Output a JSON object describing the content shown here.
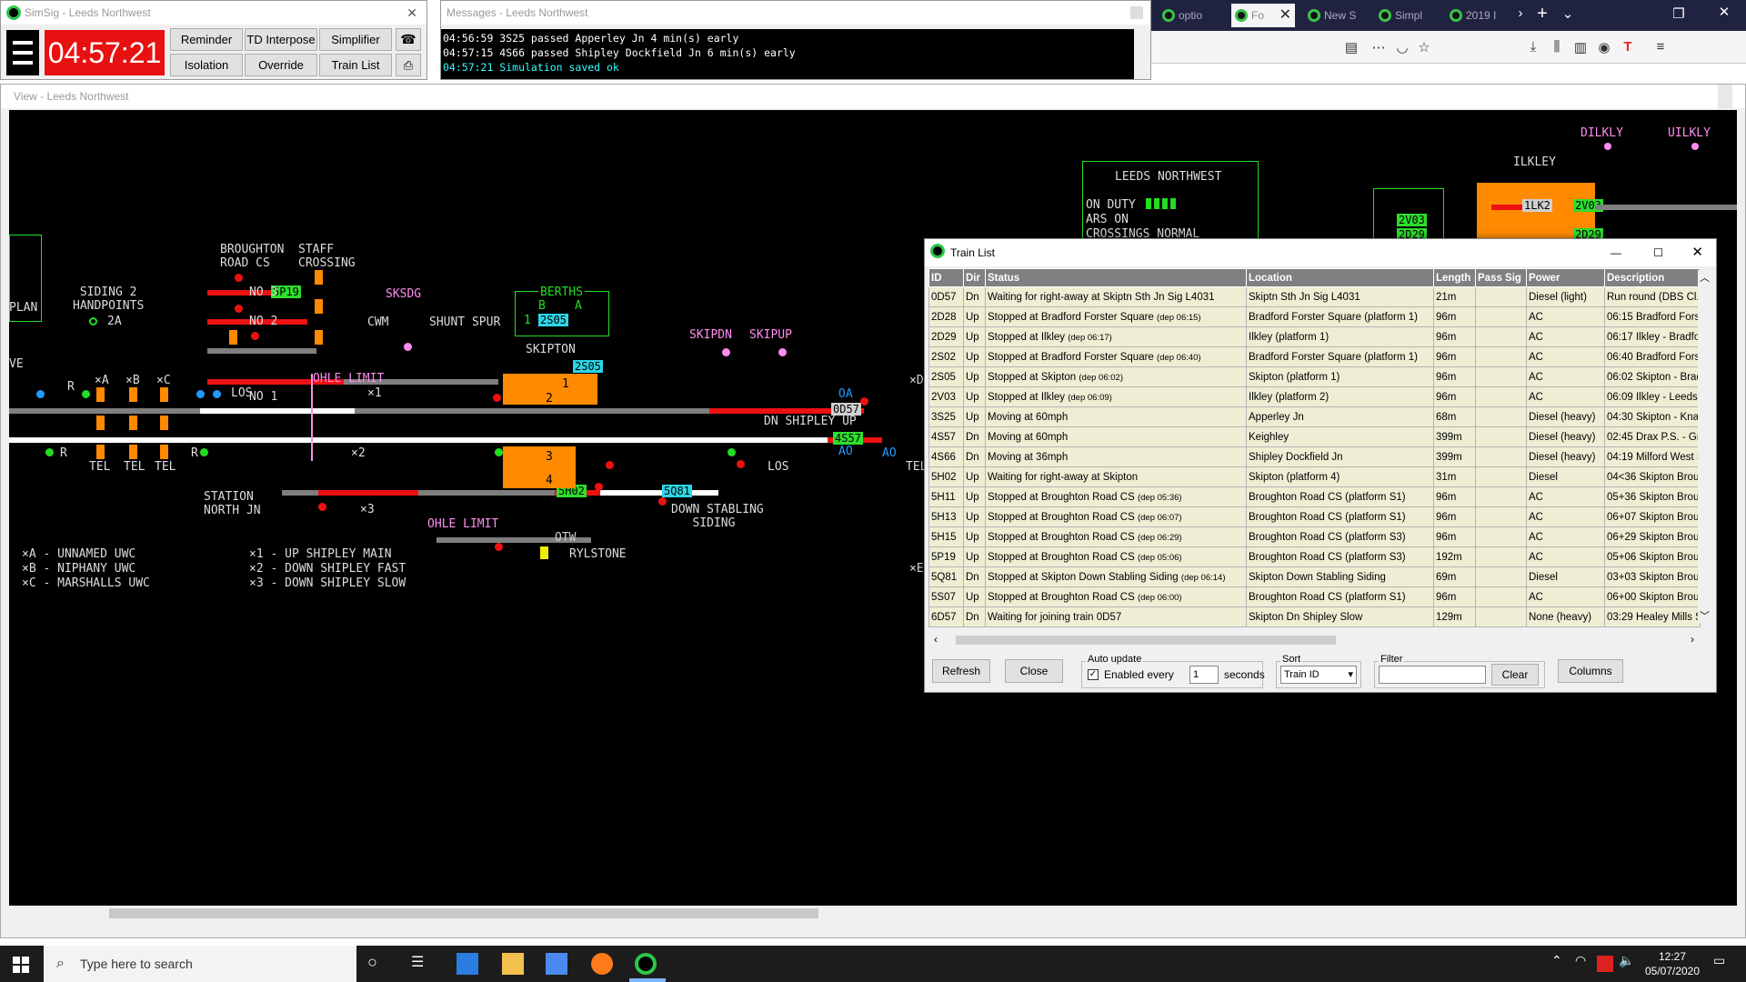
{
  "control": {
    "title": "SimSig - Leeds Northwest",
    "clock": "04:57:21",
    "buttons": {
      "reminder": "Reminder",
      "td_interpose": "TD Interpose",
      "simplifier": "Simplifier",
      "isolation": "Isolation",
      "override": "Override",
      "train_list": "Train List"
    }
  },
  "messages": {
    "title": "Messages - Leeds Northwest",
    "lines": [
      "04:56:59 3S25 passed Apperley Jn 4 min(s) early",
      "04:57:15 4S66 passed Shipley Dockfield Jn 6 min(s) early",
      "04:57:21 Simulation saved ok"
    ]
  },
  "browser": {
    "tabs": [
      "optio",
      "Fo",
      "New S",
      "Simpl",
      "2019 I"
    ]
  },
  "view": {
    "title": "View - Leeds Northwest",
    "labels": {
      "broughton": "BROUGHTON\nROAD CS",
      "staff_crossing": "STAFF\nCROSSING",
      "siding2": "SIDING 2\nHANDPOINTS",
      "siding2_hp": "2A",
      "no3": "NO 3",
      "no2": "NO 2",
      "no1": "NO 1",
      "sksdg": "SKSDG",
      "cwm": "CWM",
      "shunt_spur": "SHUNT SPUR",
      "skipton": "SKIPTON",
      "skipdn": "SKIPDN",
      "skipup": "SKIPUP",
      "plan": "PLAN",
      "ve": "VE",
      "ohle1": "OHLE LIMIT",
      "ohle2": "OHLE LIMIT",
      "los1": "LOS",
      "los2": "LOS",
      "xa": "×A",
      "xb": "×B",
      "xc": "×C",
      "x1": "×1",
      "x2": "×2",
      "x3": "×3",
      "r1": "R",
      "r2": "R",
      "r3": "R",
      "tel": "TEL",
      "station_nj": "STATION\nNORTH JN",
      "dn_shipley_up": "DN SHIPLEY UP",
      "down_stabling": "DOWN STABLING\n   SIDING",
      "otw": "OTW",
      "rylstone": "RYLSTONE",
      "legend_a": "×A - UNNAMED UWC",
      "legend_b": "×B - NIPHANY UWC",
      "legend_c": "×C - MARSHALLS UWC",
      "legend_1": "×1 - UP SHIPLEY MAIN",
      "legend_2": "×2 - DOWN SHIPLEY FAST",
      "legend_3": "×3 - DOWN SHIPLEY SLOW",
      "leeds_nw": "LEEDS NORTHWEST",
      "on_duty": "ON DUTY",
      "ars_on": "ARS ON",
      "crossings": "CROSSINGS NORMAL",
      "ilkley": "ILKLEY",
      "dilkly": "DILKLY",
      "uilkly": "UILKLY",
      "berths": "BERTHS",
      "b": "B",
      "a": "A",
      "one": "1",
      "two": "2",
      "p1": "1",
      "p2": "2",
      "p3": "3",
      "p4": "4",
      "oa": "OA",
      "ao": "AO",
      "ao2": "AO",
      "d_right": "×D",
      "e_right": "×E",
      "tel_right": "TEL"
    },
    "berths": {
      "b5p19": "5P19",
      "b2s05": "2S05",
      "b2s05b": "2S05",
      "b0d57": "0D57",
      "b4s57": "4S57",
      "b5h02": "5H02",
      "b5q81": "5Q81",
      "b2v03": "2V03",
      "b2v03b": "2V03",
      "b2d29": "2D29",
      "b2d29b": "2D29",
      "b1lk2": "1LK2"
    }
  },
  "train_list": {
    "title": "Train List",
    "columns": [
      "ID",
      "Dir",
      "Status",
      "Location",
      "Length",
      "Pass Sig",
      "Power",
      "Description"
    ],
    "rows": [
      {
        "id": "0D57",
        "dir": "Dn",
        "status": "Waiting for right-away at Skiptn Sth Jn Sig L4031",
        "dep": "",
        "location": "Skiptn Sth Jn Sig L4031",
        "length": "21m",
        "pass": "",
        "power": "Diesel (light)",
        "desc": "Run round (DBS Cl..."
      },
      {
        "id": "2D28",
        "dir": "Up",
        "status": "Stopped at Bradford Forster Square",
        "dep": "(dep 06:15)",
        "location": "Bradford Forster Square (platform 1)",
        "length": "96m",
        "pass": "",
        "power": "AC",
        "desc": "06:15 Bradford Fors"
      },
      {
        "id": "2D29",
        "dir": "Up",
        "status": "Stopped at Ilkley",
        "dep": "(dep 06:17)",
        "location": "Ilkley (platform 1)",
        "length": "96m",
        "pass": "",
        "power": "AC",
        "desc": "06:17 Ilkley - Bradfo"
      },
      {
        "id": "2S02",
        "dir": "Up",
        "status": "Stopped at Bradford Forster Square",
        "dep": "(dep 06:40)",
        "location": "Bradford Forster Square (platform 1)",
        "length": "96m",
        "pass": "",
        "power": "AC",
        "desc": "06:40 Bradford Fors"
      },
      {
        "id": "2S05",
        "dir": "Up",
        "status": "Stopped at Skipton",
        "dep": "(dep 06:02)",
        "location": "Skipton (platform 1)",
        "length": "96m",
        "pass": "",
        "power": "AC",
        "desc": "06:02 Skipton - Brad"
      },
      {
        "id": "2V03",
        "dir": "Up",
        "status": "Stopped at Ilkley",
        "dep": "(dep 06:09)",
        "location": "Ilkley (platform 2)",
        "length": "96m",
        "pass": "",
        "power": "AC",
        "desc": "06:09 Ilkley - Leeds"
      },
      {
        "id": "3S25",
        "dir": "Up",
        "status": "Moving at 60mph",
        "dep": "",
        "location": "Apperley Jn",
        "length": "68m",
        "pass": "",
        "power": "Diesel (heavy)",
        "desc": "04:30 Skipton - Kna"
      },
      {
        "id": "4S57",
        "dir": "Dn",
        "status": "Moving at 60mph",
        "dep": "",
        "location": "Keighley",
        "length": "399m",
        "pass": "",
        "power": "Diesel (heavy)",
        "desc": "02:45 Drax P.S. - Gr"
      },
      {
        "id": "4S66",
        "dir": "Dn",
        "status": "Moving at 36mph",
        "dep": "",
        "location": "Shipley Dockfield Jn",
        "length": "399m",
        "pass": "",
        "power": "Diesel (heavy)",
        "desc": "04:19 Milford West S"
      },
      {
        "id": "5H02",
        "dir": "Up",
        "status": "Waiting for right-away at Skipton",
        "dep": "",
        "location": "Skipton (platform 4)",
        "length": "31m",
        "pass": "",
        "power": "Diesel",
        "desc": "04<36 Skipton Brou"
      },
      {
        "id": "5H11",
        "dir": "Up",
        "status": "Stopped at Broughton Road CS",
        "dep": "(dep 05:36)",
        "location": "Broughton Road CS (platform S1)",
        "length": "96m",
        "pass": "",
        "power": "AC",
        "desc": "05+36 Skipton Brou"
      },
      {
        "id": "5H13",
        "dir": "Up",
        "status": "Stopped at Broughton Road CS",
        "dep": "(dep 06:07)",
        "location": "Broughton Road CS (platform S1)",
        "length": "96m",
        "pass": "",
        "power": "AC",
        "desc": "06+07 Skipton Brou"
      },
      {
        "id": "5H15",
        "dir": "Up",
        "status": "Stopped at Broughton Road CS",
        "dep": "(dep 06:29)",
        "location": "Broughton Road CS (platform S3)",
        "length": "96m",
        "pass": "",
        "power": "AC",
        "desc": "06+29 Skipton Brou"
      },
      {
        "id": "5P19",
        "dir": "Up",
        "status": "Stopped at Broughton Road CS",
        "dep": "(dep 05:06)",
        "location": "Broughton Road CS (platform S3)",
        "length": "192m",
        "pass": "",
        "power": "AC",
        "desc": "05+06 Skipton Brou"
      },
      {
        "id": "5Q81",
        "dir": "Dn",
        "status": "Stopped at Skipton Down Stabling Siding",
        "dep": "(dep 06:14)",
        "location": "Skipton Down Stabling Siding",
        "length": "69m",
        "pass": "",
        "power": "Diesel",
        "desc": "03+03 Skipton Brou"
      },
      {
        "id": "5S07",
        "dir": "Up",
        "status": "Stopped at Broughton Road CS",
        "dep": "(dep 06:00)",
        "location": "Broughton Road CS (platform S1)",
        "length": "96m",
        "pass": "",
        "power": "AC",
        "desc": "06+00 Skipton Brou"
      },
      {
        "id": "6D57",
        "dir": "Dn",
        "status": "Waiting for joining train 0D57",
        "dep": "",
        "location": "Skipton Dn Shipley Slow",
        "length": "129m",
        "pass": "",
        "power": "None (heavy)",
        "desc": "03:29 Healey Mills S"
      }
    ],
    "buttons": {
      "refresh": "Refresh",
      "close": "Close",
      "clear": "Clear",
      "columns": "Columns"
    },
    "auto_update": {
      "label": "Auto update",
      "enabled": "Enabled every",
      "value": "1",
      "unit": "seconds"
    },
    "sort": {
      "label": "Sort",
      "value": "Train ID"
    },
    "filter": {
      "label": "Filter",
      "value": ""
    }
  },
  "taskbar": {
    "search_placeholder": "Type here to search",
    "time": "12:27",
    "date": "05/07/2020"
  }
}
